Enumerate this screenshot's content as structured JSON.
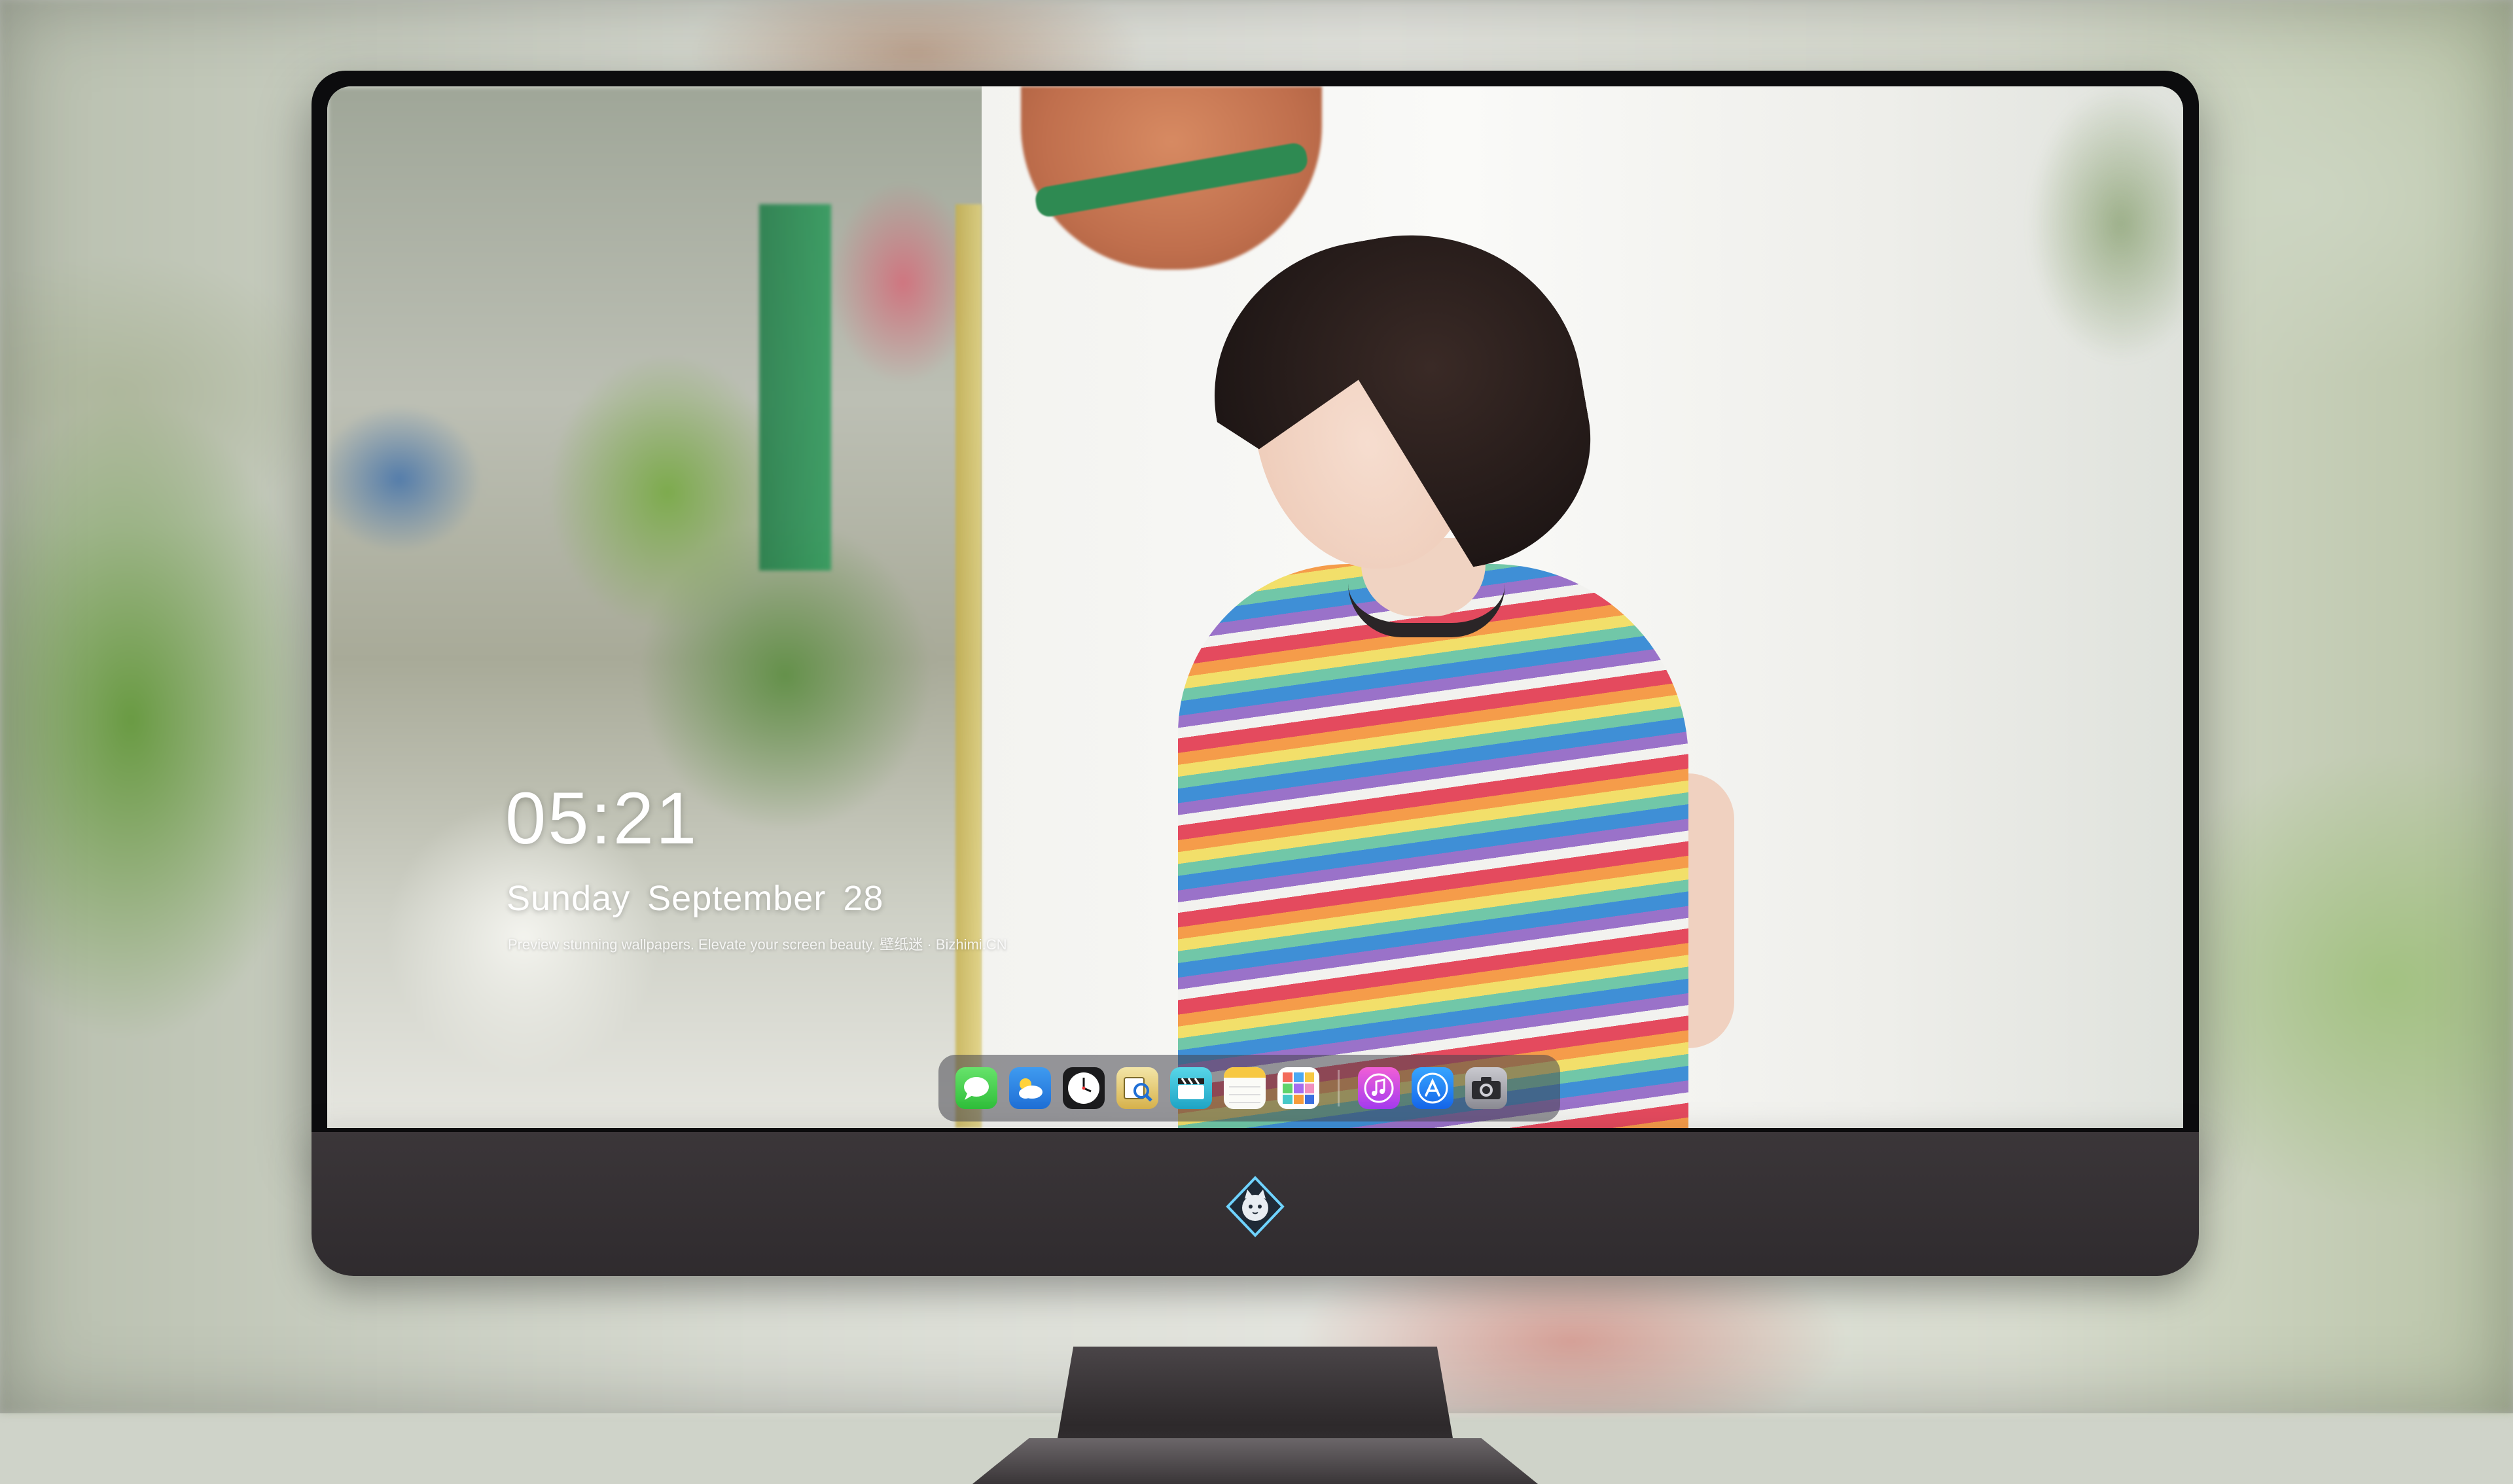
{
  "lockscreen": {
    "time": "05:21",
    "weekday": "Sunday",
    "month": "September",
    "day": "28",
    "tagline": "Preview stunning wallpapers. Elevate your screen beauty. 壁纸迷 · Bizhimi.CN"
  },
  "dock": {
    "apps": [
      {
        "name": "messages",
        "icon": "messages-icon"
      },
      {
        "name": "weather",
        "icon": "weather-icon"
      },
      {
        "name": "clock",
        "icon": "clock-icon"
      },
      {
        "name": "preview",
        "icon": "preview-icon"
      },
      {
        "name": "clips",
        "icon": "clapperboard-icon"
      },
      {
        "name": "notes",
        "icon": "notes-icon"
      },
      {
        "name": "photos",
        "icon": "photos-grid-icon"
      },
      {
        "name": "music",
        "icon": "music-note-icon"
      },
      {
        "name": "app-store",
        "icon": "app-store-icon"
      },
      {
        "name": "camera",
        "icon": "camera-icon"
      }
    ]
  },
  "monitor": {
    "chin_logo": "cat-mascot-logo"
  },
  "colors": {
    "bezel": "#0c0c0e",
    "chin": "#332f32",
    "dock_bg": "rgba(70,70,78,0.55)",
    "text": "#ffffff"
  }
}
